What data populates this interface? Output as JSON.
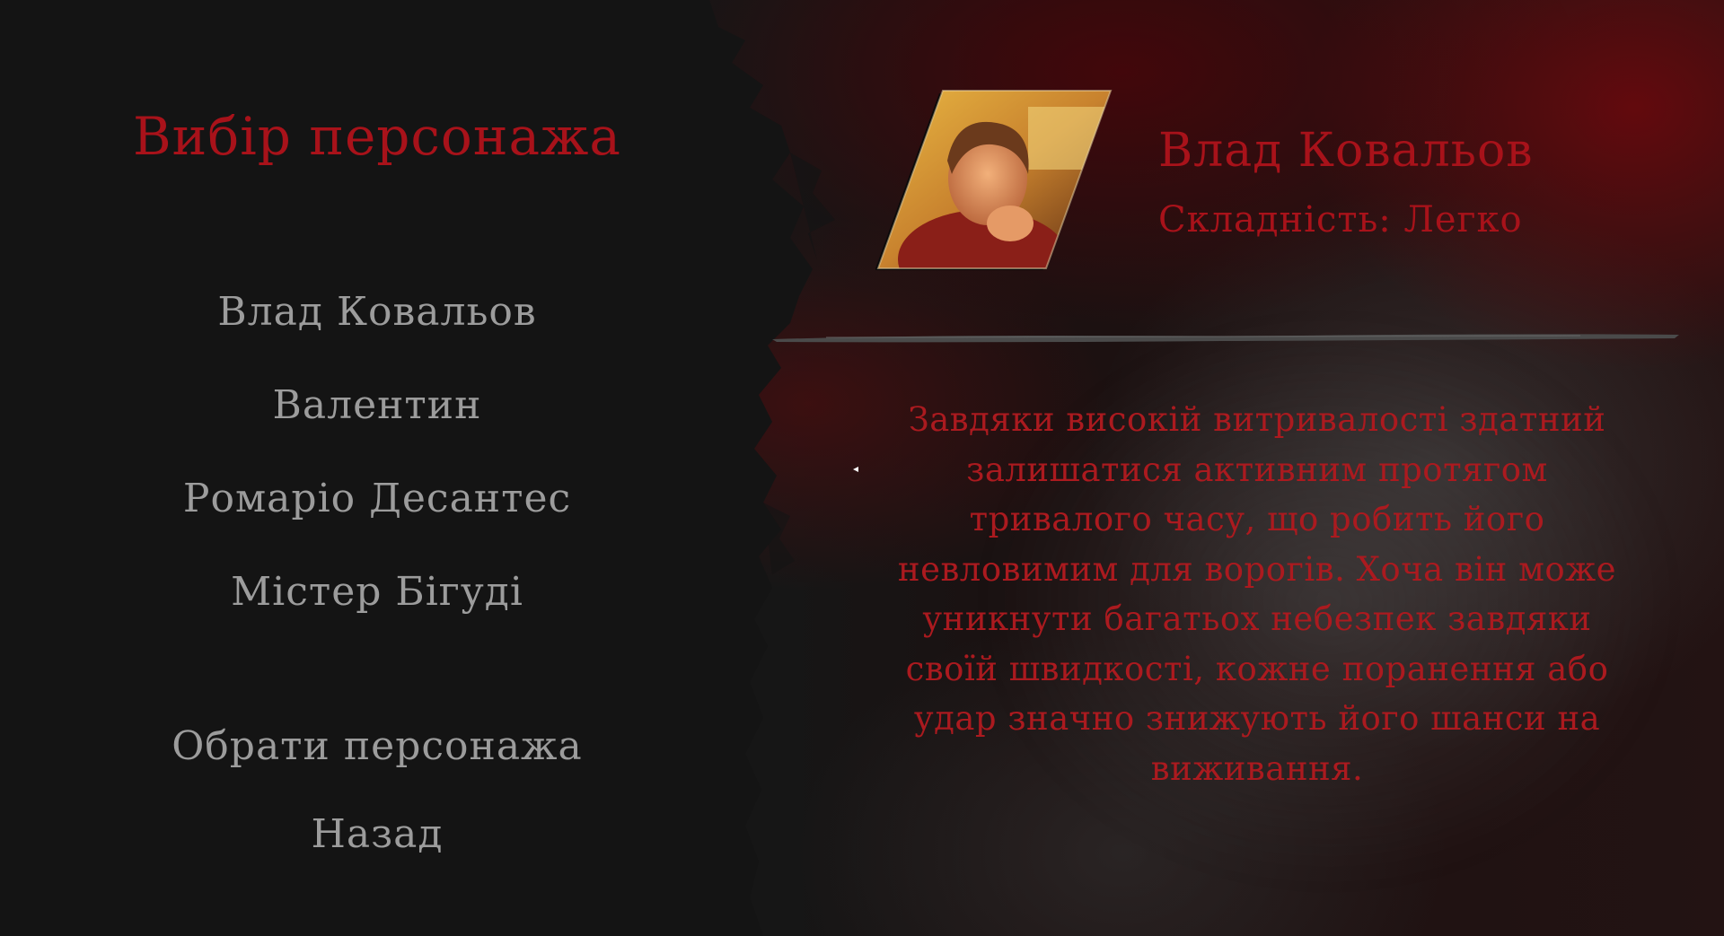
{
  "menu": {
    "title": "Вибір персонажа",
    "characters": [
      {
        "label": "Влад Ковальов"
      },
      {
        "label": "Валентин"
      },
      {
        "label": "Ромаріо Десантес"
      },
      {
        "label": "Містер Бігуді"
      }
    ],
    "actions": {
      "select_label": "Обрати персонажа",
      "back_label": "Назад"
    }
  },
  "selected_character": {
    "name": "Влад Ковальов",
    "difficulty": "Складність:  Легко",
    "description": "Завдяки високій витривалості здатний залишатися активним протягом тривалого часу, що робить його невловимим для ворогів. Хоча він може уникнути багатьох небезпек завдяки своїй швидкості, кожне поранення або удар значно знижують його шанси на виживання."
  },
  "colors": {
    "accent_red": "#a8121a",
    "menu_text": "#9c9c9c",
    "panel_dark": "#141414"
  }
}
